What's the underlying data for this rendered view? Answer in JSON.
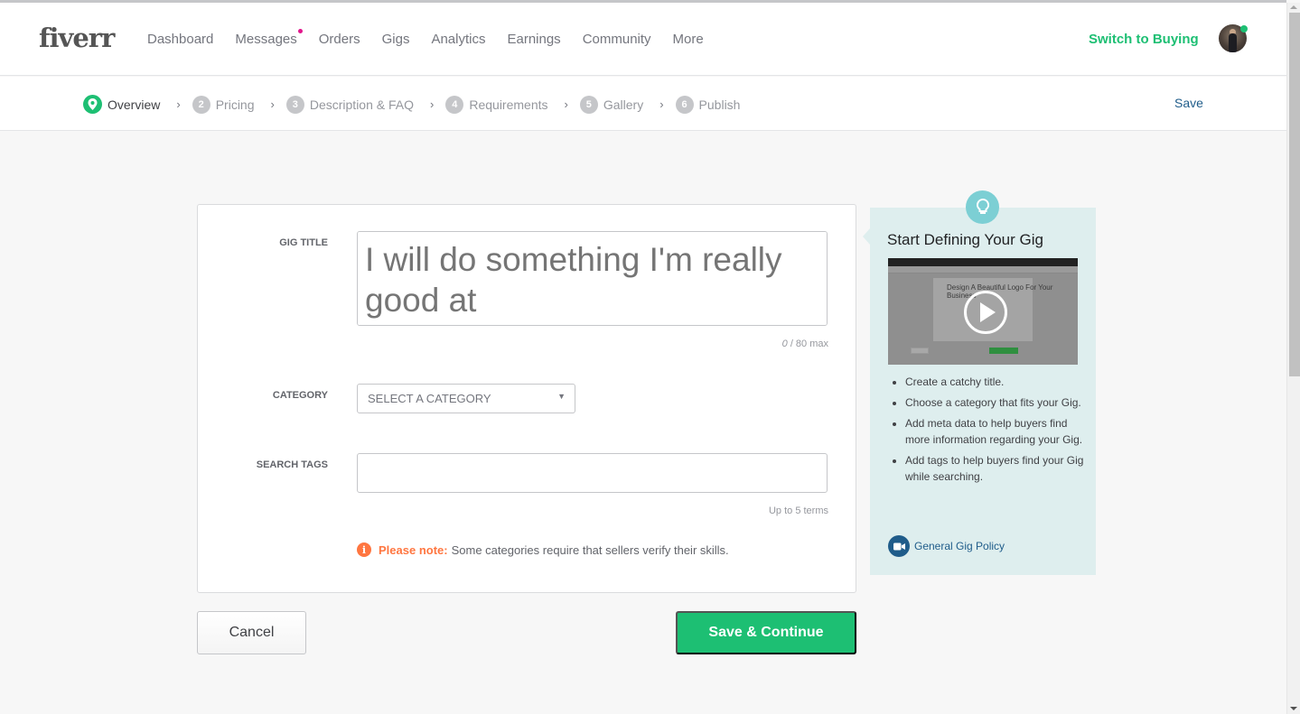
{
  "header": {
    "logo": "fiverr",
    "nav": [
      {
        "label": "Dashboard",
        "notification": false
      },
      {
        "label": "Messages",
        "notification": true
      },
      {
        "label": "Orders",
        "notification": false
      },
      {
        "label": "Gigs",
        "notification": false
      },
      {
        "label": "Analytics",
        "notification": false
      },
      {
        "label": "Earnings",
        "notification": false
      },
      {
        "label": "Community",
        "notification": false
      },
      {
        "label": "More",
        "notification": false
      }
    ],
    "switch_label": "Switch to Buying",
    "avatar_status": "online"
  },
  "steps": {
    "items": [
      {
        "number": "",
        "label": "Overview",
        "active": true,
        "icon": "location-pin-icon"
      },
      {
        "number": "2",
        "label": "Pricing",
        "active": false
      },
      {
        "number": "3",
        "label": "Description & FAQ",
        "active": false
      },
      {
        "number": "4",
        "label": "Requirements",
        "active": false
      },
      {
        "number": "5",
        "label": "Gallery",
        "active": false
      },
      {
        "number": "6",
        "label": "Publish",
        "active": false
      }
    ],
    "save_label": "Save"
  },
  "form": {
    "gig_title": {
      "label": "GIG TITLE",
      "placeholder": "I will do something I'm really good at",
      "value": "",
      "count": "0",
      "max_text": "/ 80 max"
    },
    "category": {
      "label": "CATEGORY",
      "selected": "SELECT A CATEGORY"
    },
    "search_tags": {
      "label": "SEARCH TAGS",
      "value": "",
      "hint": "Up to 5 terms"
    },
    "note": {
      "emphasis": "Please note:",
      "text": "Some categories require that sellers verify their skills."
    }
  },
  "actions": {
    "cancel": "Cancel",
    "save_continue": "Save & Continue"
  },
  "tip": {
    "title": "Start Defining Your Gig",
    "video_preview_text": "Design A Beautiful Logo For Your Business",
    "bullets": [
      "Create a catchy title.",
      "Choose a category that fits your Gig.",
      "Add meta data to help buyers find more information regarding your Gig.",
      "Add tags to help buyers find your Gig while searching."
    ],
    "policy_link": "General Gig Policy"
  },
  "colors": {
    "brand_green": "#1dbf73",
    "notification_pink": "#e2168c",
    "note_orange": "#ff7640",
    "link_blue": "#1f5c8a",
    "tip_bg": "#deeeee",
    "bulb_teal": "#7ccfd4"
  }
}
